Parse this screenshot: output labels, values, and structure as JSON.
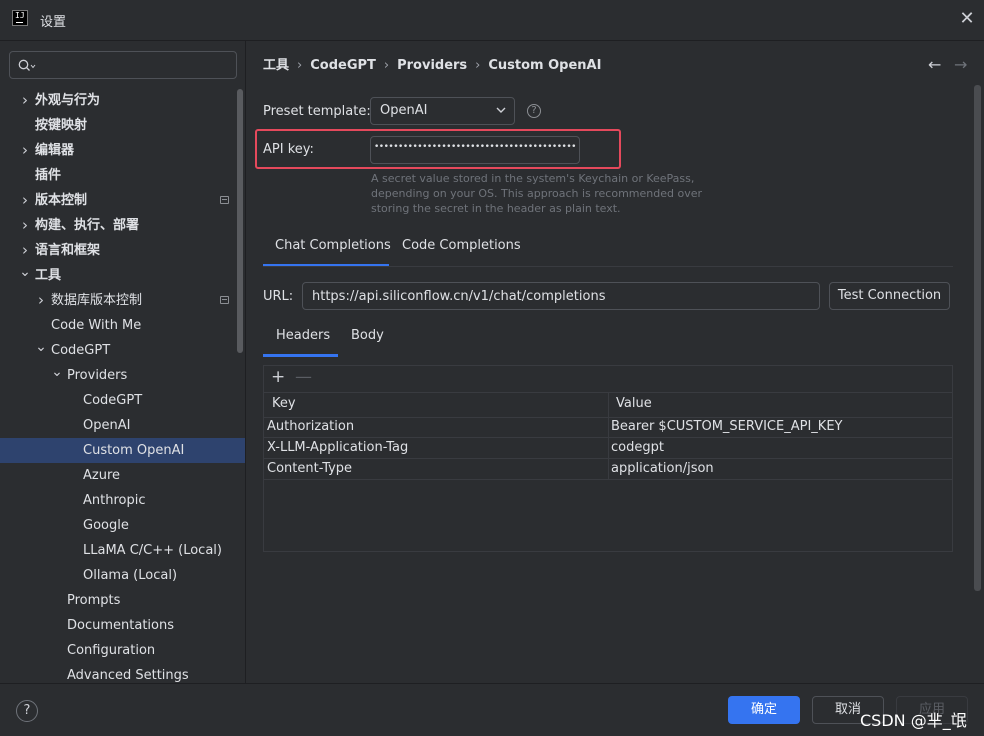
{
  "window": {
    "title": "设置",
    "close_glyph": "✕"
  },
  "sidebar": {
    "search_placeholder": "",
    "items": [
      {
        "label": "外观与行为",
        "has_chevron": true,
        "expanded": false
      },
      {
        "label": "按键映射"
      },
      {
        "label": "编辑器",
        "has_chevron": true,
        "expanded": false
      },
      {
        "label": "插件"
      },
      {
        "label": "版本控制",
        "has_chevron": true,
        "expanded": false,
        "page_icon": true
      },
      {
        "label": "构建、执行、部署",
        "has_chevron": true,
        "expanded": false
      },
      {
        "label": "语言和框架",
        "has_chevron": true,
        "expanded": false
      },
      {
        "label": "工具",
        "has_chevron": true,
        "expanded": true
      },
      {
        "label": "数据库版本控制",
        "has_chevron": true,
        "expanded": false,
        "page_icon": true
      },
      {
        "label": "Code With Me"
      },
      {
        "label": "CodeGPT",
        "has_chevron": true,
        "expanded": true
      },
      {
        "label": "Providers",
        "has_chevron": true,
        "expanded": true
      },
      {
        "label": "CodeGPT"
      },
      {
        "label": "OpenAI"
      },
      {
        "label": "Custom OpenAI",
        "selected": true
      },
      {
        "label": "Azure"
      },
      {
        "label": "Anthropic"
      },
      {
        "label": "Google"
      },
      {
        "label": "LLaMA C/C++ (Local)"
      },
      {
        "label": "Ollama (Local)"
      },
      {
        "label": "Prompts"
      },
      {
        "label": "Documentations"
      },
      {
        "label": "Configuration"
      },
      {
        "label": "Advanced Settings"
      }
    ]
  },
  "breadcrumb": [
    "工具",
    "CodeGPT",
    "Providers",
    "Custom OpenAI"
  ],
  "breadcrumb_sep": "›",
  "nav": {
    "back": "←",
    "forward": "→"
  },
  "form": {
    "preset_label": "Preset template:",
    "preset_value": "OpenAI",
    "help_glyph": "?",
    "api_key_label": "API key:",
    "api_key_value": "••••••••••••••••••••••••••••••••••••••••••",
    "api_key_hint": "A secret value stored in the system's Keychain or KeePass, depending on your OS. This approach is recommended over storing the secret in the header as plain text."
  },
  "tabs": [
    "Chat Completions",
    "Code Completions"
  ],
  "url": {
    "label": "URL:",
    "value": "https://api.siliconflow.cn/v1/chat/completions",
    "test_button": "Test Connection"
  },
  "subtabs": [
    "Headers",
    "Body"
  ],
  "table": {
    "add_glyph": "+",
    "remove_glyph": "—",
    "columns": [
      "Key",
      "Value"
    ],
    "rows": [
      [
        "Authorization",
        "Bearer $CUSTOM_SERVICE_API_KEY"
      ],
      [
        "X-LLM-Application-Tag",
        "codegpt"
      ],
      [
        "Content-Type",
        "application/json"
      ]
    ]
  },
  "footer": {
    "help_glyph": "?",
    "ok": "确定",
    "cancel": "取消",
    "apply": "应用"
  },
  "watermark": "CSDN @芈_氓",
  "colors": {
    "accent": "#3574f0",
    "selected_row": "#2e436e",
    "highlight": "#e5495c",
    "background": "#2b2d30"
  }
}
